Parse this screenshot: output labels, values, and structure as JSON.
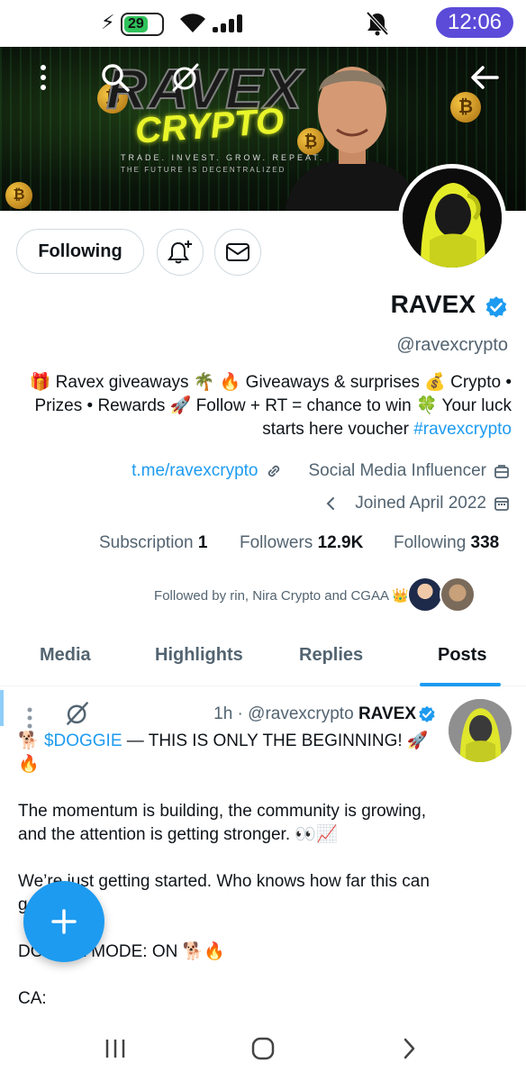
{
  "status_bar": {
    "battery": "29",
    "time": "12:06"
  },
  "banner": {
    "logo_title": "RAVEX",
    "logo_subtitle": "CRYPTO",
    "tagline": "TRADE. INVEST. GROW. REPEAT.",
    "tagline2": "THE FUTURE IS DECENTRALIZED"
  },
  "actions": {
    "following_label": "Following"
  },
  "profile": {
    "name": "RAVEX",
    "handle": "@ravexcrypto",
    "bio_text": "🎁 Ravex giveaways 🌴 🔥 Giveaways & surprises 💰 Crypto • Prizes • Rewards 🚀 Follow + RT = chance to win 🍀 Your luck starts here voucher ",
    "bio_hashtag": "#ravexcrypto",
    "link": "t.me/ravexcrypto",
    "category": "Social Media Influencer",
    "joined": "Joined April 2022",
    "subscription_label": "Subscription",
    "subscription_count": "1",
    "followers_label": "Followers",
    "followers_count": "12.9K",
    "following_label": "Following",
    "following_count": "338",
    "followed_by": "Followed by rin, Nira Crypto and CGAA 👑"
  },
  "tabs": [
    {
      "label": "Media"
    },
    {
      "label": "Highlights"
    },
    {
      "label": "Replies"
    },
    {
      "label": "Posts"
    }
  ],
  "post": {
    "time": "1h",
    "handle": "@ravexcrypto",
    "author": "RAVEX",
    "line1_prefix": "🐕 ",
    "cashtag": "$DOGGIE",
    "line1_rest": " — THIS IS ONLY THE BEGINNING! 🚀\n🔥",
    "body": "The momentum is building, the community is growing, and the attention is getting stronger. 👀📈\n\nWe’re just getting started. Who knows how far this can go? 🚀💎\n\nDOGGIE MODE: ON 🐕🔥\n\nCA:"
  },
  "colors": {
    "accent": "#1d9bf0",
    "time_pill": "#5b4bd8",
    "text_primary": "#0f1419",
    "text_secondary": "#536471"
  }
}
